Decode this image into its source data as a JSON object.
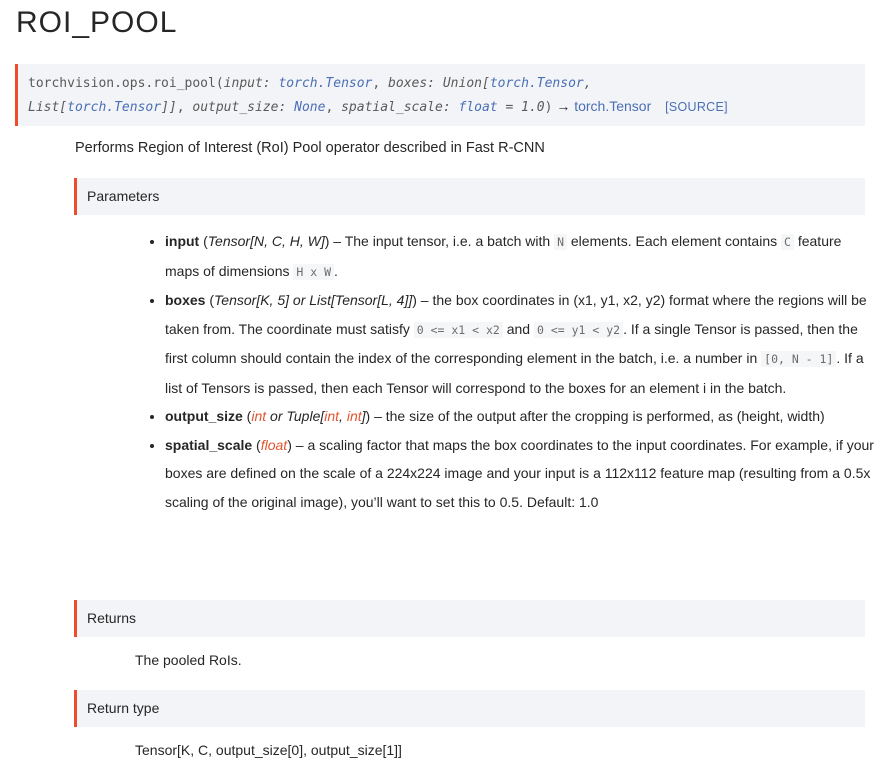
{
  "page_title": "ROI_POOL",
  "signature": {
    "prefix": "torchvision.ops.roi_pool(",
    "p1_name": "input:",
    "p1_type": "torch.Tensor",
    "sep1": ", ",
    "p2_name": "boxes:",
    "p2_type_a": "Union[",
    "p2_type_b": "torch.Tensor",
    "p2_type_c": ",",
    "p2_type_d": "List[",
    "p2_type_e": "torch.Tensor",
    "p2_type_f": "]]",
    "sep2": ", ",
    "p3_name": "output_size:",
    "p3_default": "None",
    "sep3": ", ",
    "p4_name": "spatial_scale:",
    "p4_type": "float",
    "p4_default": "= 1.0",
    "suffix": ")",
    "arrow": " → ",
    "return_type": "torch.Tensor",
    "source_link": "[SOURCE]"
  },
  "description": "Performs Region of Interest (RoI) Pool operator described in Fast R-CNN",
  "parameters": {
    "heading": "Parameters",
    "input": {
      "name": "input",
      "type_open": " (",
      "type": "Tensor[N, C, H, W]",
      "type_close": ")",
      "desc_1": " – The input tensor, i.e. a batch with ",
      "code_1": "N",
      "desc_2": " elements. Each element contains ",
      "code_2": "C",
      "desc_3": " feature maps of dimensions ",
      "code_3": "H x W",
      "desc_4": "."
    },
    "boxes": {
      "name": "boxes",
      "type_open": " (",
      "type_a": "Tensor[K, 5]",
      "type_or": " or ",
      "type_b": "List[Tensor[L, 4]]",
      "type_close": ")",
      "desc_1": " – the box coordinates in (x1, y1, x2, y2) format where the regions will be taken from. The coordinate must satisfy ",
      "code_1": "0 <= x1 < x2",
      "desc_2": " and ",
      "code_2": "0 <= y1 < y2",
      "desc_3": ". If a single Tensor is passed, then the first column should contain the index of the corresponding element in the batch, i.e. a number in ",
      "code_3": "[0, N - 1]",
      "desc_4": ". If a list of Tensors is passed, then each Tensor will correspond to the boxes for an element i in the batch."
    },
    "output_size": {
      "name": "output_size",
      "type_open": " (",
      "type_a": "int",
      "type_or": " or ",
      "type_b": "Tuple[",
      "type_c": "int",
      "type_d": ", ",
      "type_e": "int",
      "type_f": "]",
      "type_close": ")",
      "desc": " – the size of the output after the cropping is performed, as (height, width)"
    },
    "spatial_scale": {
      "name": "spatial_scale",
      "type_open": " (",
      "type": "float",
      "type_close": ")",
      "desc": " – a scaling factor that maps the box coordinates to the input coordinates. For example, if your boxes are defined on the scale of a 224x224 image and your input is a 112x112 feature map (resulting from a 0.5x scaling of the original image), you’ll want to set this to 0.5. Default: 1.0"
    }
  },
  "returns": {
    "heading": "Returns",
    "text": "The pooled RoIs."
  },
  "return_type": {
    "heading": "Return type",
    "text": "Tensor[K, C, output_size[0], output_size[1]]"
  },
  "colors": {
    "accent_bar": "#ee4c2c",
    "link": "#4a6fb5",
    "type_highlight": "#e2542f",
    "panel_bg": "#f3f4f7"
  }
}
